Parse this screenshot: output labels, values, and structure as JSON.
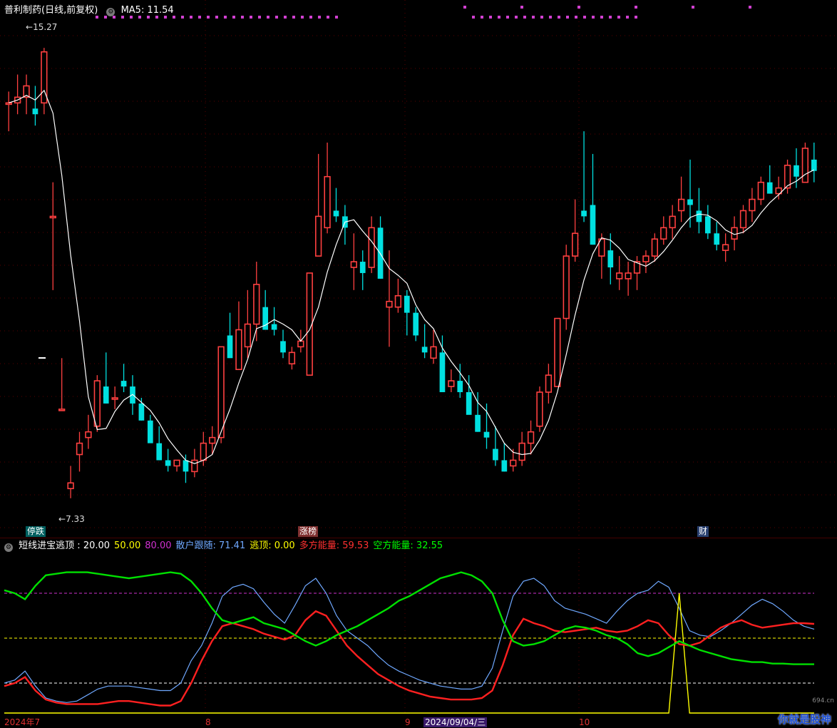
{
  "header": {
    "title": "普利制药(日线,前复权)",
    "ma_label": "MA5:",
    "ma_value": "11.54"
  },
  "main": {
    "high_label": "15.27",
    "low_label": "7.33",
    "tags": [
      "停跌",
      "涨榜",
      "财"
    ]
  },
  "indicator": {
    "name": "短线进宝逃顶",
    "lines": [
      {
        "label": "20.00",
        "color": "#ffffff"
      },
      {
        "label": "50.00",
        "color": "#ffff00"
      },
      {
        "label": "80.00",
        "color": "#d030d0"
      },
      {
        "label": "散户跟随: 71.41",
        "color": "#6fa8ff"
      },
      {
        "label": "逃顶: 0.00",
        "color": "#ffff00"
      },
      {
        "label": "多方能量: 59.53",
        "color": "#ff3030"
      },
      {
        "label": "空方能量: 32.55",
        "color": "#00ff00"
      }
    ]
  },
  "x_axis": {
    "labels": [
      "2024年7",
      "8",
      "9",
      "2024/09/04/三",
      "10"
    ]
  },
  "watermark": {
    "site": "694.cn",
    "text": "你就是股神"
  },
  "colors": {
    "up": "#ff4040",
    "down": "#00e0e0",
    "ma": "#ffffff",
    "grid": "#5a0000",
    "retail": "#6fa8ff",
    "bull": "#ff2020",
    "bear": "#00e000",
    "top": "#ffff00"
  },
  "chart_data": [
    {
      "type": "candlestick",
      "series_name": "普利制药",
      "y_scale": {
        "top_price": 15.8,
        "bottom_price": 7.0
      },
      "candles": [
        [
          14.3,
          14.5,
          13.8,
          14.3
        ],
        [
          14.3,
          14.8,
          14.1,
          14.4
        ],
        [
          14.4,
          14.8,
          14.1,
          14.6
        ],
        [
          14.2,
          14.6,
          13.9,
          14.1
        ],
        [
          14.3,
          15.27,
          14.1,
          15.2
        ],
        [
          12.3,
          12.9,
          11.0,
          12.3
        ],
        [
          8.9,
          9.8,
          8.9,
          8.9
        ],
        [
          7.5,
          7.9,
          7.33,
          7.6
        ],
        [
          8.1,
          8.5,
          7.8,
          8.3
        ],
        [
          8.4,
          8.8,
          8.2,
          8.5
        ],
        [
          8.6,
          9.5,
          8.5,
          9.4
        ],
        [
          9.3,
          9.9,
          9.0,
          9.0
        ],
        [
          9.1,
          9.3,
          8.9,
          9.1
        ],
        [
          9.4,
          9.7,
          9.2,
          9.3
        ],
        [
          9.3,
          9.5,
          8.8,
          9.0
        ],
        [
          9.0,
          9.1,
          8.7,
          8.7
        ],
        [
          8.7,
          8.8,
          8.4,
          8.3
        ],
        [
          8.3,
          8.6,
          8.0,
          8.0
        ],
        [
          8.0,
          8.2,
          7.8,
          7.9
        ],
        [
          7.9,
          8.0,
          7.8,
          8.0
        ],
        [
          8.0,
          8.1,
          7.6,
          7.8
        ],
        [
          7.8,
          8.2,
          7.7,
          8.0
        ],
        [
          8.0,
          8.5,
          7.9,
          8.3
        ],
        [
          8.3,
          8.6,
          8.1,
          8.4
        ],
        [
          8.4,
          10.0,
          8.3,
          10.0
        ],
        [
          10.2,
          10.6,
          9.9,
          9.8
        ],
        [
          9.6,
          10.8,
          9.6,
          10.3
        ],
        [
          10.0,
          11.0,
          9.8,
          10.4
        ],
        [
          10.4,
          11.5,
          10.1,
          11.1
        ],
        [
          10.7,
          11.0,
          10.3,
          10.3
        ],
        [
          10.4,
          10.7,
          10.2,
          10.3
        ],
        [
          10.1,
          10.3,
          9.8,
          9.9
        ],
        [
          9.7,
          10.0,
          9.6,
          9.9
        ],
        [
          10.0,
          10.3,
          9.9,
          10.1
        ],
        [
          9.5,
          11.2,
          9.5,
          11.3
        ],
        [
          11.6,
          13.4,
          11.6,
          12.3
        ],
        [
          12.1,
          13.6,
          12.0,
          13.0
        ],
        [
          12.4,
          12.8,
          12.2,
          12.3
        ],
        [
          12.3,
          12.5,
          11.8,
          12.1
        ],
        [
          11.4,
          12.0,
          11.0,
          11.5
        ],
        [
          11.5,
          11.7,
          11.0,
          11.3
        ],
        [
          11.4,
          12.3,
          11.3,
          12.1
        ],
        [
          12.1,
          12.3,
          11.2,
          11.2
        ],
        [
          10.7,
          11.7,
          10.0,
          10.8
        ],
        [
          10.7,
          11.2,
          10.6,
          10.9
        ],
        [
          10.9,
          11.0,
          10.2,
          10.6
        ],
        [
          10.6,
          10.7,
          10.1,
          10.2
        ],
        [
          10.0,
          10.4,
          9.8,
          9.9
        ],
        [
          9.8,
          10.3,
          9.7,
          10.0
        ],
        [
          9.9,
          10.2,
          9.4,
          9.2
        ],
        [
          9.3,
          9.6,
          9.2,
          9.4
        ],
        [
          9.4,
          9.7,
          9.1,
          9.2
        ],
        [
          9.2,
          9.5,
          8.9,
          8.8
        ],
        [
          8.8,
          9.2,
          8.5,
          8.5
        ],
        [
          8.5,
          9.0,
          8.2,
          8.4
        ],
        [
          8.2,
          8.6,
          7.9,
          8.0
        ],
        [
          8.0,
          8.3,
          7.8,
          7.8
        ],
        [
          7.9,
          8.2,
          7.8,
          8.0
        ],
        [
          8.0,
          8.5,
          7.9,
          8.3
        ],
        [
          8.3,
          8.7,
          8.1,
          8.5
        ],
        [
          8.6,
          9.3,
          8.5,
          9.2
        ],
        [
          9.2,
          9.7,
          9.0,
          9.5
        ],
        [
          9.3,
          10.5,
          9.3,
          10.5
        ],
        [
          10.5,
          11.8,
          10.3,
          11.6
        ],
        [
          11.6,
          12.6,
          11.5,
          12.0
        ],
        [
          12.4,
          13.8,
          12.2,
          12.3
        ],
        [
          12.5,
          13.4,
          11.8,
          11.8
        ],
        [
          11.6,
          12.0,
          11.2,
          11.9
        ],
        [
          11.7,
          12.0,
          11.1,
          11.4
        ],
        [
          11.2,
          11.6,
          11.0,
          11.3
        ],
        [
          11.2,
          11.5,
          10.9,
          11.3
        ],
        [
          11.3,
          11.6,
          11.0,
          11.5
        ],
        [
          11.5,
          11.7,
          11.3,
          11.6
        ],
        [
          11.6,
          12.0,
          11.5,
          11.9
        ],
        [
          11.9,
          12.3,
          11.8,
          12.1
        ],
        [
          12.1,
          12.5,
          11.9,
          12.3
        ],
        [
          12.4,
          13.0,
          12.2,
          12.6
        ],
        [
          12.6,
          13.3,
          12.1,
          12.5
        ],
        [
          12.4,
          12.8,
          12.0,
          12.2
        ],
        [
          12.3,
          12.5,
          11.9,
          12.0
        ],
        [
          12.0,
          12.2,
          11.7,
          11.8
        ],
        [
          11.7,
          12.0,
          11.5,
          11.8
        ],
        [
          11.9,
          12.3,
          11.7,
          12.1
        ],
        [
          12.1,
          12.5,
          12.0,
          12.4
        ],
        [
          12.4,
          12.8,
          12.2,
          12.6
        ],
        [
          12.6,
          13.0,
          12.5,
          12.9
        ],
        [
          12.9,
          13.2,
          12.7,
          12.7
        ],
        [
          12.7,
          13.0,
          12.6,
          12.8
        ],
        [
          12.8,
          13.3,
          12.7,
          13.2
        ],
        [
          13.2,
          13.5,
          12.8,
          13.0
        ],
        [
          12.9,
          13.6,
          12.9,
          13.5
        ],
        [
          13.3,
          13.6,
          12.9,
          13.1
        ]
      ]
    },
    {
      "type": "line",
      "title": "短线进宝逃顶",
      "levels": [
        20,
        50,
        80
      ],
      "ylim": [
        0,
        100
      ],
      "series": [
        {
          "name": "散户跟随",
          "values": [
            20,
            22,
            28,
            18,
            10,
            8,
            7,
            8,
            12,
            16,
            18,
            18,
            18,
            17,
            16,
            15,
            15,
            20,
            35,
            45,
            60,
            78,
            84,
            86,
            83,
            74,
            66,
            60,
            72,
            85,
            90,
            80,
            65,
            55,
            50,
            45,
            38,
            32,
            28,
            25,
            22,
            20,
            18,
            17,
            16,
            16,
            18,
            30,
            55,
            78,
            88,
            90,
            85,
            75,
            70,
            68,
            66,
            63,
            60,
            68,
            75,
            80,
            82,
            88,
            84,
            70,
            55,
            52,
            51,
            55,
            60,
            66,
            72,
            76,
            73,
            68,
            62,
            58,
            56
          ]
        },
        {
          "name": "逃顶",
          "values": [
            0,
            0,
            0,
            0,
            0,
            0,
            0,
            0,
            0,
            0,
            0,
            0,
            0,
            0,
            0,
            0,
            0,
            0,
            0,
            0,
            0,
            0,
            0,
            0,
            0,
            0,
            0,
            0,
            0,
            0,
            0,
            0,
            0,
            0,
            0,
            0,
            0,
            0,
            0,
            0,
            0,
            0,
            0,
            0,
            0,
            0,
            0,
            0,
            0,
            0,
            0,
            0,
            0,
            0,
            0,
            0,
            0,
            0,
            0,
            0,
            0,
            0,
            0,
            0,
            0,
            80,
            0,
            0,
            0,
            0,
            0,
            0,
            0,
            0,
            0,
            0,
            0,
            0,
            0
          ]
        },
        {
          "name": "多方能量",
          "values": [
            18,
            20,
            24,
            15,
            9,
            7,
            6,
            6,
            6,
            6,
            7,
            8,
            8,
            7,
            6,
            5,
            5,
            8,
            20,
            35,
            48,
            58,
            60,
            58,
            56,
            53,
            51,
            49,
            52,
            62,
            68,
            65,
            55,
            45,
            38,
            32,
            26,
            22,
            18,
            15,
            13,
            11,
            10,
            9,
            9,
            9,
            10,
            15,
            32,
            52,
            63,
            60,
            58,
            55,
            54,
            55,
            56,
            57,
            55,
            54,
            55,
            58,
            62,
            60,
            52,
            46,
            45,
            47,
            52,
            57,
            60,
            62,
            59,
            57,
            58,
            59,
            60,
            60,
            59.53
          ]
        },
        {
          "name": "空方能量",
          "values": [
            82,
            80,
            76,
            85,
            92,
            93,
            94,
            94,
            94,
            93,
            92,
            91,
            90,
            91,
            92,
            93,
            94,
            93,
            88,
            80,
            70,
            62,
            60,
            62,
            64,
            60,
            58,
            56,
            52,
            48,
            45,
            48,
            52,
            55,
            58,
            62,
            66,
            70,
            75,
            78,
            82,
            86,
            90,
            92,
            94,
            92,
            88,
            80,
            62,
            48,
            45,
            46,
            48,
            52,
            56,
            58,
            57,
            55,
            52,
            50,
            46,
            40,
            38,
            40,
            44,
            48,
            45,
            42,
            40,
            38,
            36,
            35,
            34,
            34,
            33,
            33,
            32.55,
            32.55,
            32.55
          ]
        }
      ]
    }
  ]
}
